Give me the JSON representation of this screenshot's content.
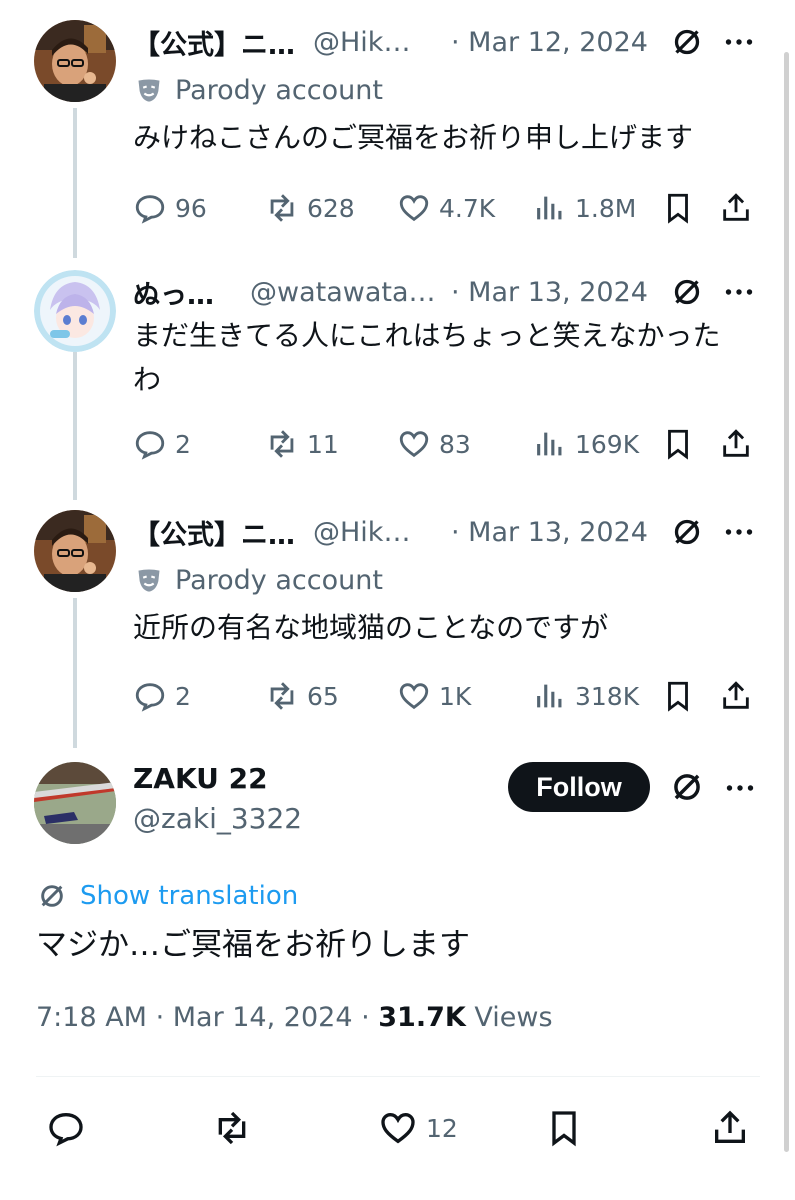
{
  "thread": [
    {
      "name": "【公式】ニ…",
      "handle": "@Hik…",
      "date": "Mar 12, 2024",
      "parody_label": "Parody account",
      "text": "みけねこさんのご冥福をお祈り申し上げます",
      "replies": "96",
      "reposts": "628",
      "likes": "4.7K",
      "views": "1.8M"
    },
    {
      "name": "ぬっ…",
      "handle": "@watawata…",
      "date": "Mar 13, 2024",
      "text_line1": "まだ生きてる人にこれはちょっと笑えなかった",
      "text_line2": "わ",
      "replies": "2",
      "reposts": "11",
      "likes": "83",
      "views": "169K"
    },
    {
      "name": "【公式】ニ…",
      "handle": "@Hik…",
      "date": "Mar 13, 2024",
      "parody_label": "Parody account",
      "text": "近所の有名な地域猫のことなのですが",
      "replies": "2",
      "reposts": "65",
      "likes": "1K",
      "views": "318K"
    }
  ],
  "main": {
    "name": "ZAKU 22",
    "handle": "@zaki_3322",
    "follow_label": "Follow",
    "translate_label": "Show translation",
    "text": "マジか…ご冥福をお祈りします",
    "time": "7:18 AM",
    "date": "Mar 14, 2024",
    "views_count": "31.7K",
    "views_label": "Views",
    "likes": "12"
  },
  "colors": {
    "text": "#0f1419",
    "secondary": "#536471",
    "link": "#1d9bf0",
    "thread_line": "#cfd9de"
  },
  "icons": [
    "reply-icon",
    "repost-icon",
    "like-icon",
    "views-icon",
    "bookmark-icon",
    "share-icon",
    "grok-icon",
    "more-icon",
    "parody-mask-icon",
    "translate-icon"
  ]
}
